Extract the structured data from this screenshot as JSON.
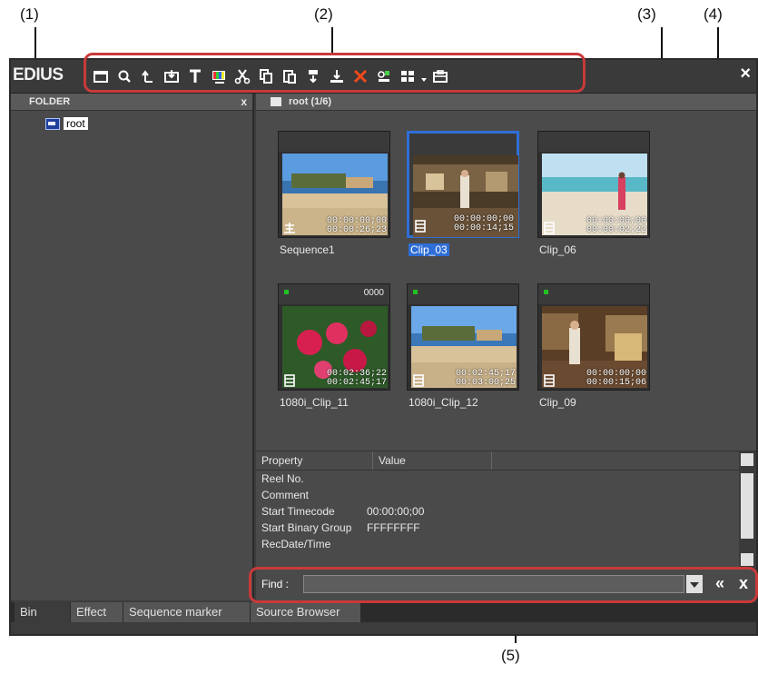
{
  "callouts": [
    "(1)",
    "(2)",
    "(3)",
    "(4)",
    "(5)"
  ],
  "window": {
    "app_name": "EDIUS",
    "close": "×"
  },
  "toolbar": {
    "icons": [
      "new-folder-icon",
      "search-icon",
      "up-folder-icon",
      "import-icon",
      "title-icon",
      "color-bar-icon",
      "cut-icon",
      "copy-icon",
      "paste-icon",
      "add-to-player-icon",
      "add-to-timeline-icon",
      "delete-icon",
      "properties-icon",
      "view-mode-icon",
      "view-dropdown-icon",
      "open-browser-icon"
    ]
  },
  "folder_pane": {
    "header": "FOLDER",
    "close": "x",
    "root_label": "root"
  },
  "bin": {
    "header": "root (1/6)",
    "clips": [
      {
        "name": "Sequence1",
        "tc_in": "00:00:00;00",
        "tc_dur": "00:00:26;23",
        "type": "sequence",
        "selected": false,
        "marker": false,
        "counter": ""
      },
      {
        "name": "Clip_03",
        "tc_in": "00:00:00;00",
        "tc_dur": "00:00:14;15",
        "type": "clip",
        "selected": true,
        "marker": false,
        "counter": ""
      },
      {
        "name": "Clip_06",
        "tc_in": "00:00:00;00",
        "tc_dur": "00:00:02;22",
        "type": "clip",
        "selected": false,
        "marker": false,
        "counter": ""
      },
      {
        "name": "1080i_Clip_11",
        "tc_in": "00:02:36;22",
        "tc_dur": "00:02:45;17",
        "type": "clip",
        "selected": false,
        "marker": true,
        "counter": "0000"
      },
      {
        "name": "1080i_Clip_12",
        "tc_in": "00:02:45;17",
        "tc_dur": "00:03:00;25",
        "type": "clip",
        "selected": false,
        "marker": true,
        "counter": ""
      },
      {
        "name": "Clip_09",
        "tc_in": "00:00:00;00",
        "tc_dur": "00:00:15;06",
        "type": "clip",
        "selected": false,
        "marker": true,
        "counter": ""
      }
    ]
  },
  "properties": {
    "columns": [
      "Property",
      "Value"
    ],
    "rows": [
      {
        "prop": "Reel No.",
        "value": ""
      },
      {
        "prop": "Comment",
        "value": ""
      },
      {
        "prop": "Start Timecode",
        "value": "00:00:00;00"
      },
      {
        "prop": "Start Binary Group",
        "value": "FFFFFFFF"
      },
      {
        "prop": "RecDate/Time",
        "value": ""
      }
    ]
  },
  "find": {
    "label": "Find :",
    "value": "",
    "prev": "«",
    "close": "x"
  },
  "tabs": [
    "Bin",
    "Effect",
    "Sequence marker",
    "Source Browser"
  ],
  "colors": {
    "highlight": "#c83a3a",
    "selection": "#2f6ed6",
    "marker": "#22c022"
  }
}
